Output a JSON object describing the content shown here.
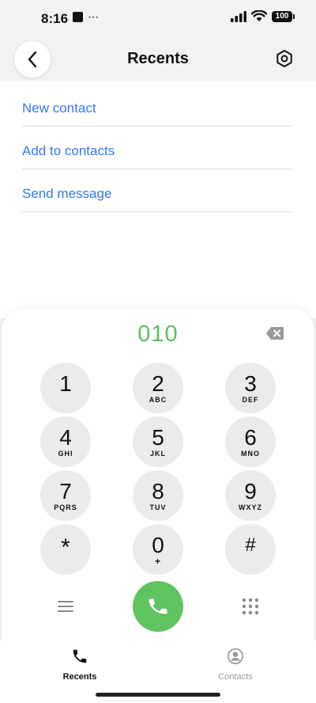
{
  "status_bar": {
    "time": "8:16",
    "more": "⋯",
    "battery": "100"
  },
  "header": {
    "title": "Recents"
  },
  "actions": [
    {
      "label": "New contact"
    },
    {
      "label": "Add to contacts"
    },
    {
      "label": "Send message"
    }
  ],
  "dialer": {
    "number": "010",
    "keys": [
      {
        "digit": "1",
        "letters": ""
      },
      {
        "digit": "2",
        "letters": "ABC"
      },
      {
        "digit": "3",
        "letters": "DEF"
      },
      {
        "digit": "4",
        "letters": "GHI"
      },
      {
        "digit": "5",
        "letters": "JKL"
      },
      {
        "digit": "6",
        "letters": "MNO"
      },
      {
        "digit": "7",
        "letters": "PQRS"
      },
      {
        "digit": "8",
        "letters": "TUV"
      },
      {
        "digit": "9",
        "letters": "WXYZ"
      },
      {
        "digit": "*",
        "letters": ""
      },
      {
        "digit": "0",
        "letters": "+"
      },
      {
        "digit": "#",
        "letters": ""
      }
    ]
  },
  "tabs": [
    {
      "label": "Recents",
      "active": true
    },
    {
      "label": "Contacts",
      "active": false
    }
  ],
  "colors": {
    "accent_link": "#3478f6",
    "call_green": "#5fc35f",
    "number_green": "#5fbf5f",
    "key_bg": "#ebebeb"
  },
  "icons": {
    "back": "chevron-left-icon",
    "settings": "hexagon-settings-icon",
    "backspace": "backspace-icon",
    "menu": "menu-icon",
    "call": "phone-icon",
    "keypad": "keypad-grid-icon",
    "recents_tab": "phone-icon",
    "contacts_tab": "person-circle-icon"
  }
}
